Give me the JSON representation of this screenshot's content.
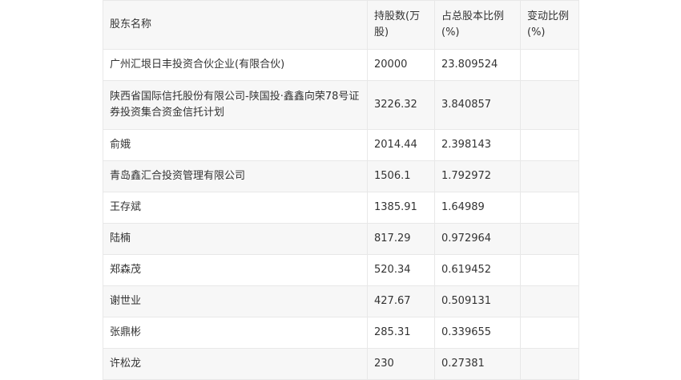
{
  "table": {
    "headers": [
      "股东名称",
      "持股数(万股)",
      "占总股本比例(%)",
      "变动比例(%)"
    ],
    "rows": [
      {
        "name": "广州汇垠日丰投资合伙企业(有限合伙)",
        "shares": "20000",
        "ratio": "23.809524",
        "change": ""
      },
      {
        "name": "陕西省国际信托股份有限公司-陕国投·鑫鑫向荣78号证券投资集合资金信托计划",
        "shares": "3226.32",
        "ratio": "3.840857",
        "change": ""
      },
      {
        "name": "俞娥",
        "shares": "2014.44",
        "ratio": "2.398143",
        "change": ""
      },
      {
        "name": "青岛鑫汇合投资管理有限公司",
        "shares": "1506.1",
        "ratio": "1.792972",
        "change": ""
      },
      {
        "name": "王存斌",
        "shares": "1385.91",
        "ratio": "1.64989",
        "change": ""
      },
      {
        "name": "陆楠",
        "shares": "817.29",
        "ratio": "0.972964",
        "change": ""
      },
      {
        "name": "郑森茂",
        "shares": "520.34",
        "ratio": "0.619452",
        "change": ""
      },
      {
        "name": "谢世业",
        "shares": "427.67",
        "ratio": "0.509131",
        "change": ""
      },
      {
        "name": "张鼎彬",
        "shares": "285.31",
        "ratio": "0.339655",
        "change": ""
      },
      {
        "name": "许松龙",
        "shares": "230",
        "ratio": "0.27381",
        "change": ""
      }
    ]
  }
}
